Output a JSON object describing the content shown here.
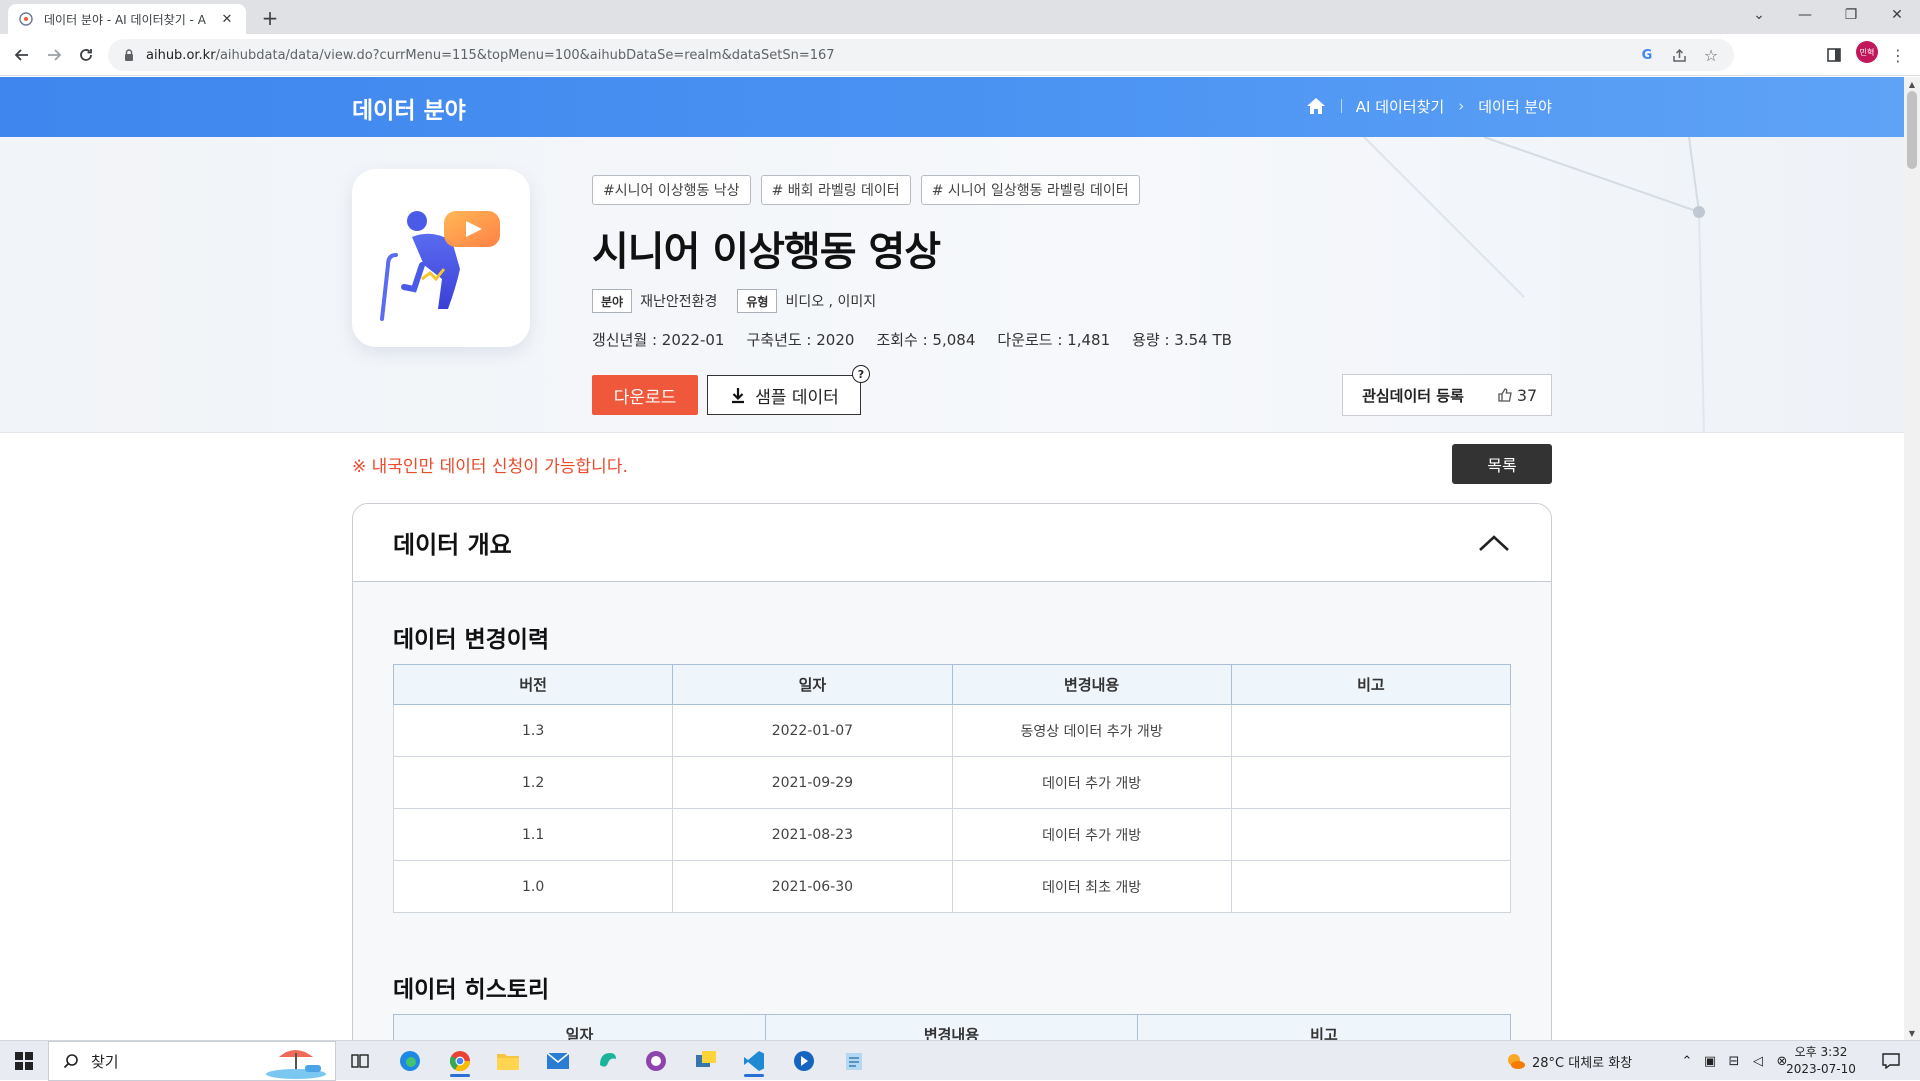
{
  "browser": {
    "tab_title": "데이터 분야 - AI 데이터찾기 - A",
    "url_host": "aihub.or.kr",
    "url_path": "/aihubdata/data/view.do?currMenu=115&topMenu=100&aihubDataSe=realm&dataSetSn=167",
    "avatar_text": "민혁"
  },
  "header": {
    "section_title": "데이터 분야",
    "breadcrumb": [
      "AI 데이터찾기",
      "데이터 분야"
    ]
  },
  "dataset": {
    "tags": [
      "#시니어 이상행동 낙상",
      "# 배회 라벨링 데이터",
      "# 시니어 일상행동 라벨링 데이터"
    ],
    "title": "시니어 이상행동 영상",
    "field_label": "분야",
    "field_value": "재난안전환경",
    "type_label": "유형",
    "type_value": "비디오 , 이미지",
    "stats": [
      "갱신년월 : 2022-01",
      "구축년도 : 2020",
      "조회수 : 5,084",
      "다운로드 : 1,481",
      "용량 : 3.54 TB"
    ],
    "download_label": "다운로드",
    "sample_label": "샘플 데이터",
    "help_glyph": "?",
    "favorite_label": "관심데이터 등록",
    "like_count": "37"
  },
  "notice": "※ 내국인만 데이터 신청이 가능합니다.",
  "list_button": "목록",
  "overview": {
    "title": "데이터 개요",
    "change_history": {
      "title": "데이터 변경이력",
      "headers": [
        "버전",
        "일자",
        "변경내용",
        "비고"
      ],
      "rows": [
        [
          "1.3",
          "2022-01-07",
          "동영상 데이터 추가 개방",
          ""
        ],
        [
          "1.2",
          "2021-09-29",
          "데이터 추가 개방",
          ""
        ],
        [
          "1.1",
          "2021-08-23",
          "데이터 추가 개방",
          ""
        ],
        [
          "1.0",
          "2021-06-30",
          "데이터 최초 개방",
          ""
        ]
      ]
    },
    "history": {
      "title": "데이터 히스토리",
      "headers": [
        "일자",
        "변경내용",
        "비고"
      ]
    }
  },
  "taskbar": {
    "search_placeholder": "찾기",
    "weather": "28°C  대체로 화창",
    "time": "오후 3:32",
    "date": "2023-07-10"
  },
  "colors": {
    "accent_blue": "#4a92f2",
    "download_red": "#f0583b",
    "notice_red": "#ea4b2d"
  }
}
